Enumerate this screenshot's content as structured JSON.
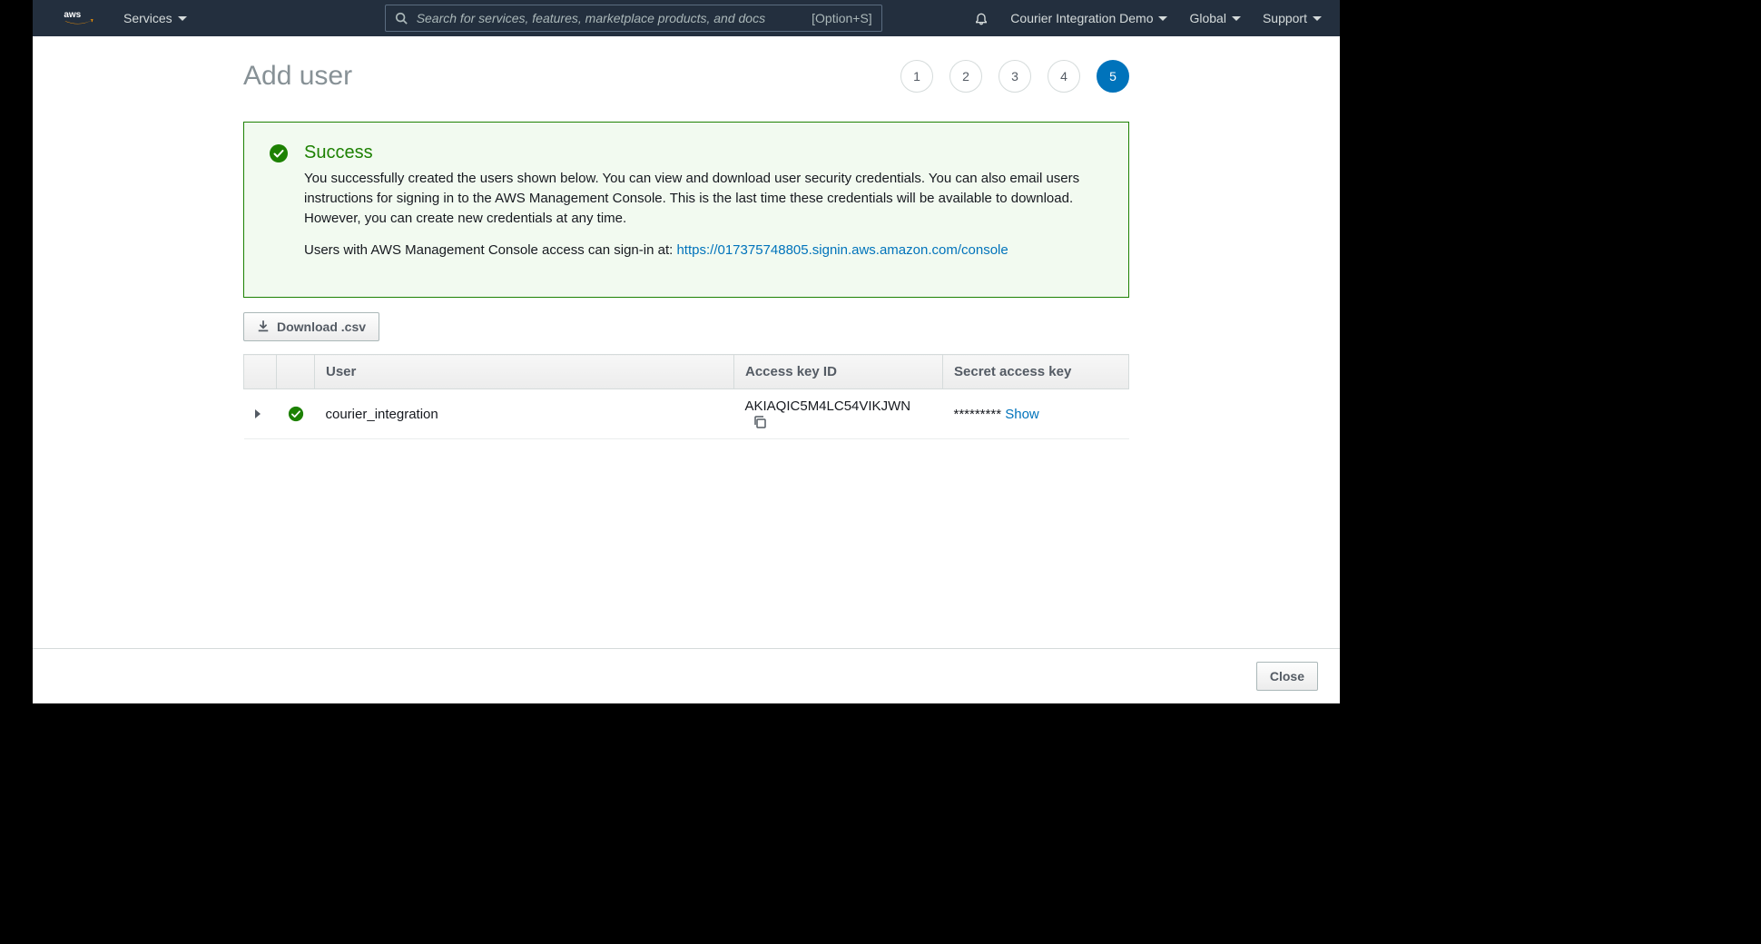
{
  "topnav": {
    "services_label": "Services",
    "search_placeholder": "Search for services, features, marketplace products, and docs",
    "search_shortcut": "[Option+S]",
    "account_label": "Courier Integration Demo",
    "region_label": "Global",
    "support_label": "Support"
  },
  "page": {
    "title": "Add user"
  },
  "steps": [
    "1",
    "2",
    "3",
    "4",
    "5"
  ],
  "active_step_index": 4,
  "alert": {
    "heading": "Success",
    "body": "You successfully created the users shown below. You can view and download user security credentials. You can also email users instructions for signing in to the AWS Management Console. This is the last time these credentials will be available to download. However, you can create new credentials at any time.",
    "signin_prefix": "Users with AWS Management Console access can sign-in at: ",
    "signin_url": "https://017375748805.signin.aws.amazon.com/console"
  },
  "download_button": "Download .csv",
  "table": {
    "headers": {
      "user": "User",
      "access_key": "Access key ID",
      "secret": "Secret access key"
    },
    "rows": [
      {
        "user": "courier_integration",
        "access_key_id": "AKIAQIC5M4LC54VIKJWN",
        "secret_masked": "*********",
        "show_label": "Show"
      }
    ]
  },
  "footer": {
    "close_label": "Close"
  }
}
